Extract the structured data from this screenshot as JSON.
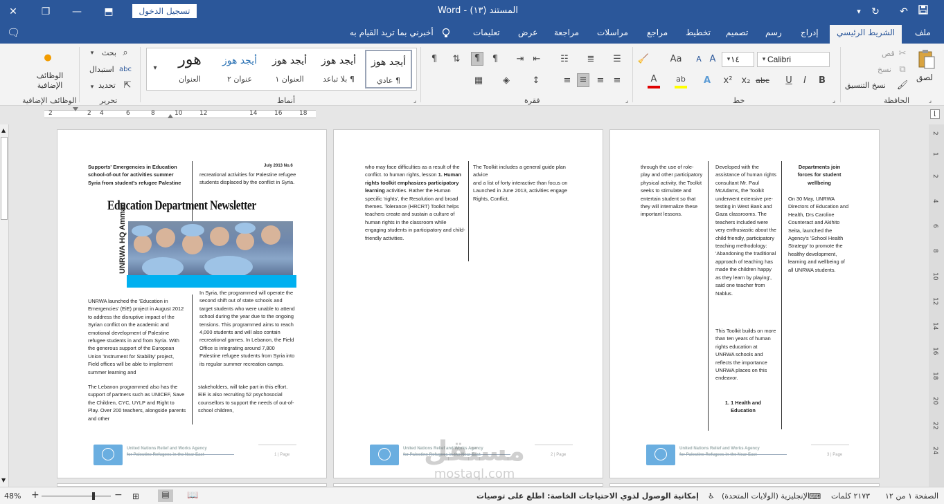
{
  "titlebar": {
    "title": "المستند (١٣)  -  Word",
    "signin_label": "تسجيل الدخول",
    "close_glyph": "✕",
    "restore_glyph": "❐",
    "ribbon_display_glyph": "⬒",
    "minimize_glyph": "—",
    "save_glyph": "💾",
    "undo_glyph": "↶",
    "redo_glyph": "↻",
    "customize_glyph": "▾"
  },
  "tabs": {
    "file": "ملف",
    "home": "الشريط الرئيسي",
    "insert": "إدراج",
    "draw": "رسم",
    "design": "تصميم",
    "layout": "تخطيط",
    "references": "مراجع",
    "mailings": "مراسلات",
    "review": "مراجعة",
    "view": "عرض",
    "help": "تعليمات",
    "tell_me": "أخبرني بما تريد القيام به",
    "comment_glyph": "🗨"
  },
  "ribbon": {
    "clipboard": {
      "label": "الحافظة",
      "paste": "لصق",
      "cut": "قص",
      "copy": "نسخ",
      "format_painter": "نسخ التنسيق"
    },
    "font": {
      "label": "خط",
      "font_name": "Calibri",
      "font_size": "١٤",
      "bold": "B",
      "italic": "I",
      "underline": "U",
      "strike": "abc",
      "subscript": "x₂",
      "superscript": "x²",
      "effects": "A",
      "highlight": "ab",
      "color": "A",
      "case": "Aa",
      "clear": "A"
    },
    "paragraph": {
      "label": "فقرة"
    },
    "styles": {
      "label": "أنماط",
      "items": [
        {
          "sample": "أيجد هوز",
          "name": "¶ عادي"
        },
        {
          "sample": "أيجد هوز",
          "name": "¶ بلا تباعد"
        },
        {
          "sample": "أيجد هوز",
          "name": "العنوان ١"
        },
        {
          "sample": "أيجد هوز",
          "name": "عنوان ٢"
        },
        {
          "sample": "هور",
          "name": "العنوان"
        }
      ]
    },
    "editing": {
      "label": "تحرير",
      "find": "بحث",
      "replace": "استبدال",
      "select": "تحديد"
    },
    "addins": {
      "label": "الوظائف الإضافية",
      "button": "الوظائف الإضافية"
    }
  },
  "ruler": {
    "ticks": [
      "2",
      "2",
      "4",
      "6",
      "8",
      "10",
      "12",
      "14",
      "16",
      "18"
    ]
  },
  "vruler": {
    "ticks": [
      "2",
      "1",
      "2",
      "4",
      "6",
      "8",
      "10",
      "12",
      "14",
      "16",
      "18",
      "20",
      "22",
      "24"
    ]
  },
  "page1": {
    "col_left_head": "Supports' Emergencies in Education school-of-out for activities summer Syria from student's refugee Palestine",
    "date": "July 2013 No.6",
    "col_right_top": "recreational activities for Palestine refugee students displaced by the conflict in Syria.",
    "newsletter": "Education Department Newsletter",
    "vertical_label": "UNRWA HQ Amman",
    "col_left_body": "UNRWA launched the 'Education in Emergencies' (EiE) project in August 2012 to address the disruptive impact of the Syrian conflict on the academic and emotional development of Palestine refugee students in and from Syria. With the generous support of the European Union 'Instrument for Stability' project, Field offices will be able to implement summer learning and",
    "col_left_body2": "The Lebanon programmed also has the support of partners such as UNICEF, Save the Children, CYC, UYLP and Right to Play. Over 200 teachers, alongside parents and other",
    "col_right_body": "In Syria, the programmed will operate the second shift out of state schools and target students who were unable to attend school during the year due to the ongoing tensions. This programmed aims to reach 4,000 students and will also contain recreational games. In Lebanon, the Field Office is integrating around 7,800 Palestine refugee students from Syria into its regular summer recreation camps.",
    "col_right_body2": "stakeholders, will take part in this effort. EiE is also recruiting 52 psychosocial counsellors to support the needs of out-of-school children,",
    "footer_org": "United Nations Relief and Works Agency",
    "footer_org2": "for Palestine Refugees in the Near East",
    "page_no": "1 | Page"
  },
  "page2": {
    "col_left": "who may face difficulties as a result of the conflict. to human rights, lesson",
    "col_left_bold": "1. Human rights toolkit emphasizes participatory learning",
    "col_left_rest": " activities. Rather the Human specific 'rights', the Resolution and broad themes. Tolerance (HRCRT) Toolkit helps teachers create and sustain a culture of human rights in the classroom   while engaging students in participatory and child-friendly activities.",
    "col_right": "The Toolkit includes a general guide plan advice",
    "col_right2": "and a list of forty interactive than focus on Launched in June 2013, activities engage Rights, Conflict,",
    "footer_org": "United Nations Relief and Works Agency",
    "footer_org2": "for Palestine Refugees in the Near East",
    "page_no": "2 | Page"
  },
  "page3": {
    "col1": "through the use of role- play and other participatory physical activity, the Toolkit seeks to stimulate and entertain student so that they will internalize these important lessons.",
    "col2": "Developed with the assistance of human rights consultant Mr. Paul McAdams, the Toolkit underwent extensive pre- testing in West Bank and Gaza classrooms. The teachers included were very enthusiastic about the child friendly, participatory teaching methodology: 'Abandoning the traditional approach of teaching has made the children happy as they learn by playing', said one teacher from Nablus.",
    "col2b": "This Toolkit builds on more than ten years of human rights education at UNRWA schools and reflects the importance UNRWA places on this endeavor.",
    "col2_head": "1. 1 Health and Education",
    "col3_head": "Departments join forces for student wellbeing",
    "col3": "On 30 May, UNRWA Directors of Education and Health, Drs Caroline Counteract and Akihito Seita, launched the Agency's 'School Health Strategy' to promote the healthy development, learning and wellbeing of all UNRWA students.",
    "footer_org": "United Nations Relief and Works Agency",
    "footer_org2": "for Palestine Refugees in the Near East",
    "page_no": "3 | Page"
  },
  "statusbar": {
    "page": "الصفحة ١ من ١٢",
    "words": "٢١٧٣ كلمات",
    "language": "الإنجليزية (الولايات المتحدة)",
    "accessibility": "إمكانية الوصول لذوي الاحتياجات الخاصة: اطلع على توصيات",
    "zoom": "48%",
    "zoom_minus": "−",
    "zoom_plus": "+"
  },
  "watermark": {
    "line1": "مستقل",
    "line2": "mostaql.com"
  }
}
